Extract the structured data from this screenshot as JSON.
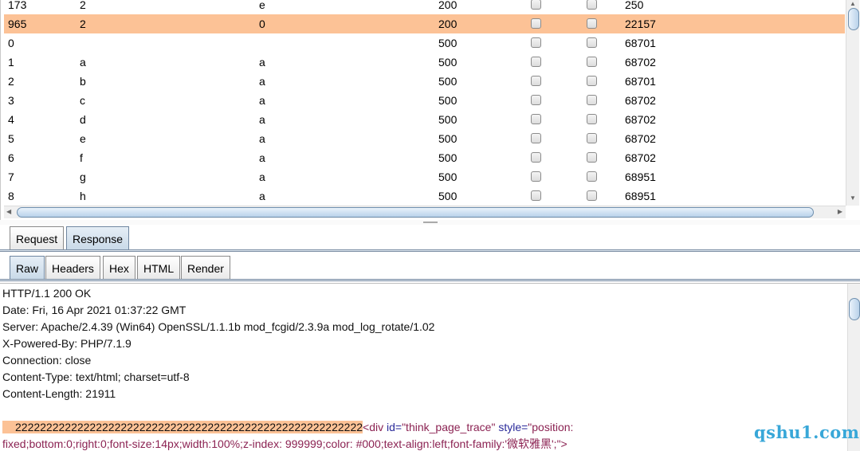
{
  "results": {
    "rows": [
      {
        "id": "173",
        "p1": "2",
        "p2": "e",
        "status": "200",
        "error": false,
        "timeout": false,
        "length": "250",
        "selected": false
      },
      {
        "id": "965",
        "p1": "2",
        "p2": "0",
        "status": "200",
        "error": false,
        "timeout": false,
        "length": "22157",
        "selected": true
      },
      {
        "id": "0",
        "p1": "",
        "p2": "",
        "status": "500",
        "error": false,
        "timeout": false,
        "length": "68701",
        "selected": false
      },
      {
        "id": "1",
        "p1": "a",
        "p2": "a",
        "status": "500",
        "error": false,
        "timeout": false,
        "length": "68702",
        "selected": false
      },
      {
        "id": "2",
        "p1": "b",
        "p2": "a",
        "status": "500",
        "error": false,
        "timeout": false,
        "length": "68701",
        "selected": false
      },
      {
        "id": "3",
        "p1": "c",
        "p2": "a",
        "status": "500",
        "error": false,
        "timeout": false,
        "length": "68702",
        "selected": false
      },
      {
        "id": "4",
        "p1": "d",
        "p2": "a",
        "status": "500",
        "error": false,
        "timeout": false,
        "length": "68702",
        "selected": false
      },
      {
        "id": "5",
        "p1": "e",
        "p2": "a",
        "status": "500",
        "error": false,
        "timeout": false,
        "length": "68702",
        "selected": false
      },
      {
        "id": "6",
        "p1": "f",
        "p2": "a",
        "status": "500",
        "error": false,
        "timeout": false,
        "length": "68702",
        "selected": false
      },
      {
        "id": "7",
        "p1": "g",
        "p2": "a",
        "status": "500",
        "error": false,
        "timeout": false,
        "length": "68951",
        "selected": false
      },
      {
        "id": "8",
        "p1": "h",
        "p2": "a",
        "status": "500",
        "error": false,
        "timeout": false,
        "length": "68951",
        "selected": false
      }
    ]
  },
  "message_tabs": [
    {
      "label": "Request",
      "active": false
    },
    {
      "label": "Response",
      "active": true
    }
  ],
  "view_tabs": [
    {
      "label": "Raw",
      "active": true
    },
    {
      "label": "Headers",
      "active": false
    },
    {
      "label": "Hex",
      "active": false
    },
    {
      "label": "HTML",
      "active": false
    },
    {
      "label": "Render",
      "active": false
    }
  ],
  "response": {
    "status_line": "HTTP/1.1 200 OK",
    "date": "Date: Fri, 16 Apr 2021 01:37:22 GMT",
    "server": "Server: Apache/2.4.39 (Win64) OpenSSL/1.1.1b mod_fcgid/2.3.9a mod_log_rotate/1.02",
    "powered_by": "X-Powered-By: PHP/7.1.9",
    "connection": "Connection: close",
    "content_type": "Content-Type: text/html; charset=utf-8",
    "content_length": "Content-Length: 21911",
    "highlighted_body": "22222222222222222222222222222222222222222222222222222222",
    "tag_open": "<div",
    "attr_id": "id=",
    "val_id": "\"think_page_trace\"",
    "attr_style": "style=",
    "val_style_1": "\"position:",
    "val_style_2": "fixed;bottom:0;right:0;font-size:14px;width:100%;z-index: 999999;color: #000;text-align:left;font-family:'微软雅黑';\">"
  },
  "watermark": "qshu1.com",
  "colors": {
    "selection": "#fcc296",
    "watermark": "#38a7d8",
    "tab_active": "#c9d9e8"
  }
}
